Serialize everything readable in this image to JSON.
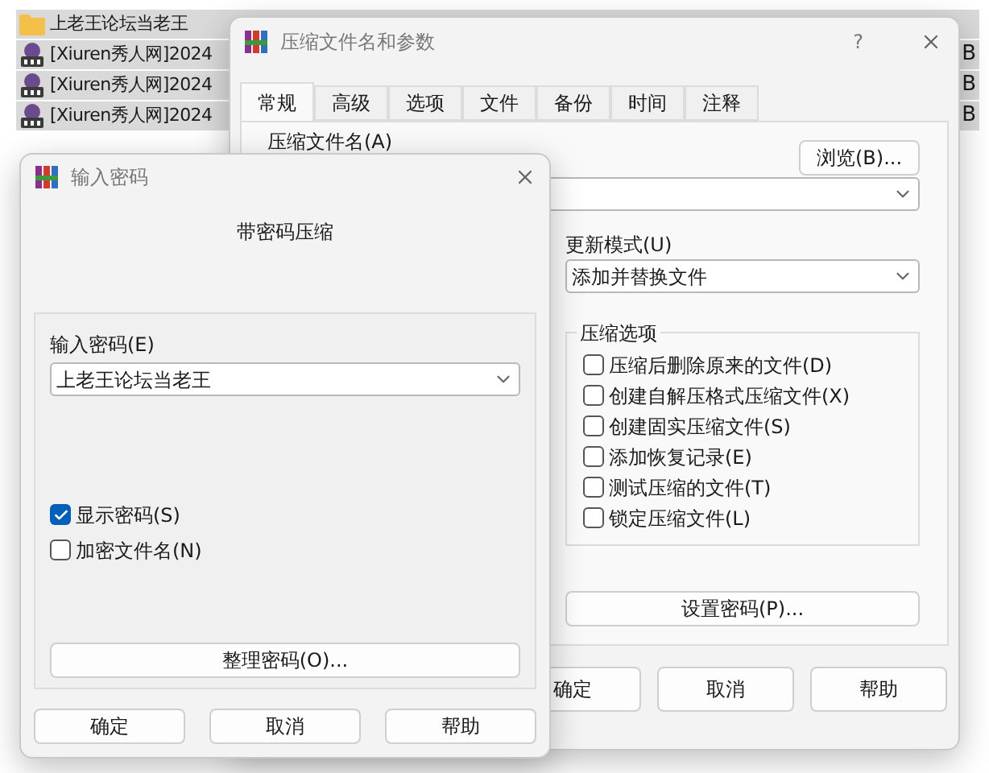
{
  "file_list": [
    {
      "kind": "folder",
      "name": "上老王论坛当老王",
      "selected": true
    },
    {
      "kind": "archive",
      "name": "[Xiuren秀人网]2024",
      "size": "B",
      "selected": true
    },
    {
      "kind": "archive",
      "name": "[Xiuren秀人网]2024",
      "size": "B",
      "selected": true
    },
    {
      "kind": "archive",
      "name": "[Xiuren秀人网]2024",
      "size": "B",
      "selected": true
    }
  ],
  "archive_dialog": {
    "title": "压缩文件名和参数",
    "help_glyph": "?",
    "tabs": [
      {
        "label": "常规",
        "selected": true
      },
      {
        "label": "高级",
        "selected": false
      },
      {
        "label": "选项",
        "selected": false
      },
      {
        "label": "文件",
        "selected": false
      },
      {
        "label": "备份",
        "selected": false
      },
      {
        "label": "时间",
        "selected": false
      },
      {
        "label": "注释",
        "selected": false
      }
    ],
    "archive_name_label": "压缩文件名(A)",
    "browse_button": "浏览(B)...",
    "update_mode_label": "更新模式(U)",
    "update_mode": "添加并替换文件",
    "options_group": "压缩选项",
    "options": [
      {
        "label": "压缩后删除原来的文件(D)",
        "checked": false
      },
      {
        "label": "创建自解压格式压缩文件(X)",
        "checked": false
      },
      {
        "label": "创建固实压缩文件(S)",
        "checked": false
      },
      {
        "label": "添加恢复记录(E)",
        "checked": false
      },
      {
        "label": "测试压缩的文件(T)",
        "checked": false
      },
      {
        "label": "锁定压缩文件(L)",
        "checked": false
      }
    ],
    "set_password_button": "设置密码(P)...",
    "buttons": [
      "确定",
      "取消",
      "帮助"
    ]
  },
  "password_dialog": {
    "title": "输入密码",
    "heading": "带密码压缩",
    "password_label": "输入密码(E)",
    "password": "上老王论坛当老王",
    "options": [
      {
        "label": "显示密码(S)",
        "checked": true
      },
      {
        "label": "加密文件名(N)",
        "checked": false
      }
    ],
    "organize_button": "整理密码(O)...",
    "buttons": [
      "确定",
      "取消",
      "帮助"
    ]
  }
}
